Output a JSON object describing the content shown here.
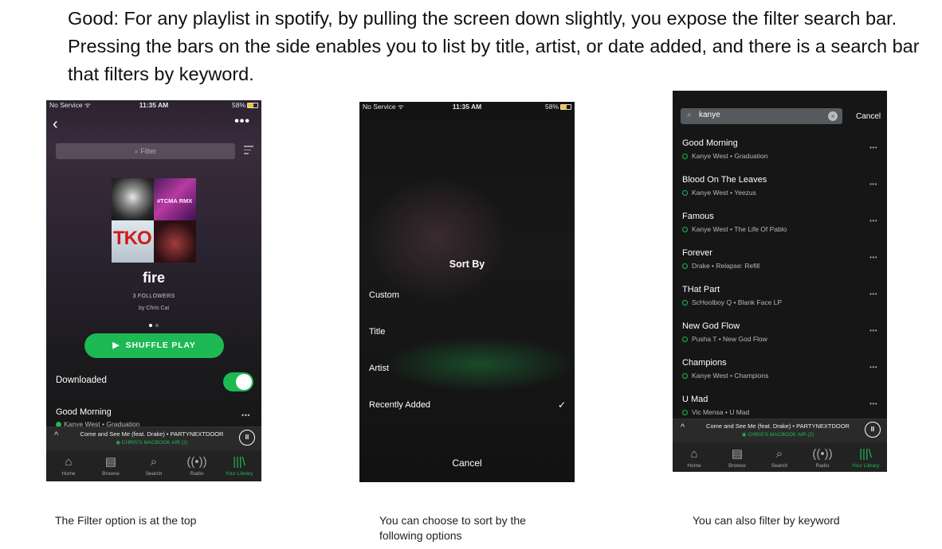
{
  "intro": "Good: For any playlist in spotify, by pulling the screen down slightly, you expose the filter search bar. Pressing the bars on the side enables you to list by title, artist, or date added, and there is a search bar that filters by keyword.",
  "status": {
    "carrier": "No Service",
    "time": "11:35 AM",
    "battery": "58%"
  },
  "playlist": {
    "back_icon": "chevron-left-icon",
    "more": "•••",
    "filter_placeholder": "Filter",
    "cover_text_1": "TKO",
    "cover_text_2": "#TCMA RMX",
    "name": "fire",
    "followers": "3 FOLLOWERS",
    "owner": "by Chris Cai",
    "shuffle_label": "SHUFFLE PLAY",
    "downloaded_label": "Downloaded",
    "downloaded_on": true,
    "first_song": {
      "title": "Good Morning",
      "subtitle": "Kanye West • Graduation",
      "more": "•••"
    }
  },
  "now_playing": {
    "text": "Come and See Me (feat. Drake) • PARTYNEXTDOOR",
    "device": "CHRIS'S MACBOOK AIR (2)"
  },
  "tabs": [
    {
      "label": "Home",
      "icon": "home-icon"
    },
    {
      "label": "Browse",
      "icon": "browse-icon"
    },
    {
      "label": "Search",
      "icon": "search-icon"
    },
    {
      "label": "Radio",
      "icon": "radio-icon"
    },
    {
      "label": "Your Library",
      "icon": "library-icon",
      "active": true
    }
  ],
  "sort": {
    "title": "Sort By",
    "options": [
      "Custom",
      "Title",
      "Artist",
      "Recently Added"
    ],
    "selected": "Recently Added",
    "check": "✓",
    "cancel": "Cancel"
  },
  "search": {
    "query": "kanye",
    "cancel": "Cancel",
    "results": [
      {
        "title": "Good Morning",
        "subtitle": "Kanye West • Graduation"
      },
      {
        "title": "Blood On The Leaves",
        "subtitle": "Kanye West • Yeezus"
      },
      {
        "title": "Famous",
        "subtitle": "Kanye West • The Life Of Pablo"
      },
      {
        "title": "Forever",
        "subtitle": "Drake • Relapse: Refill"
      },
      {
        "title": "THat Part",
        "subtitle": "ScHoolboy Q • Blank Face LP"
      },
      {
        "title": "New God Flow",
        "subtitle": "Pusha T • New God Flow"
      },
      {
        "title": "Champions",
        "subtitle": "Kanye West • Champions"
      },
      {
        "title": "U Mad",
        "subtitle": "Vic Mensa • U Mad"
      }
    ],
    "more": "•••"
  },
  "captions": [
    "The Filter option is at the top",
    "You can choose to sort by the following options",
    "You can also filter by keyword"
  ],
  "colors": {
    "accent": "#1db954"
  }
}
